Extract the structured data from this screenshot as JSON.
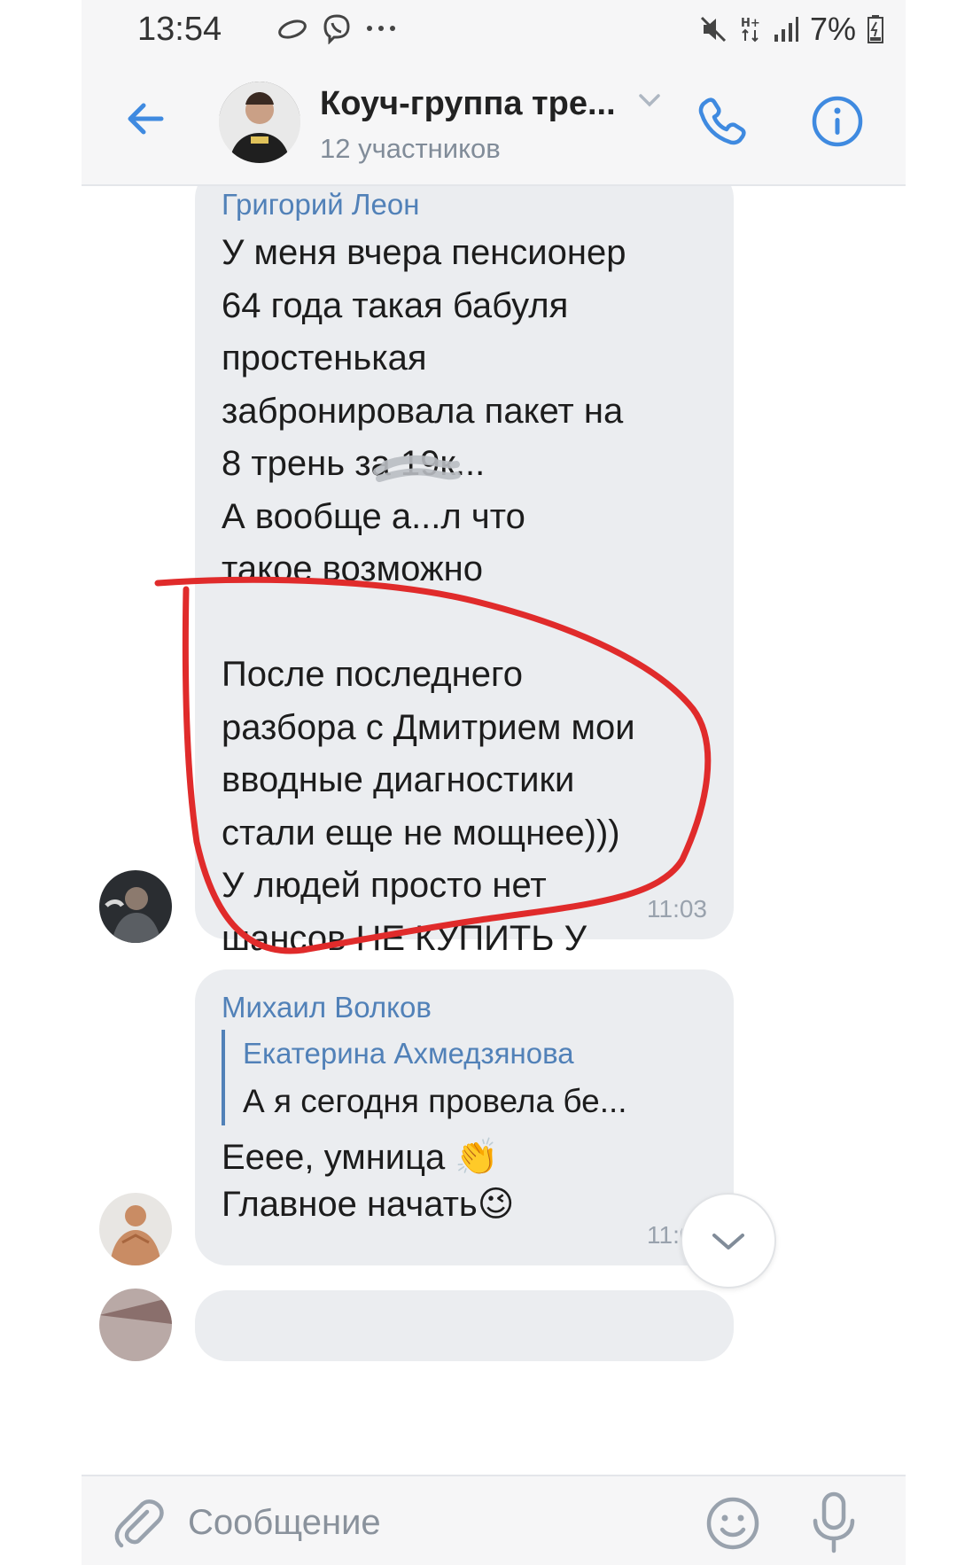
{
  "status_bar": {
    "time": "13:54",
    "battery": "7%"
  },
  "header": {
    "title": "Коуч-группа тре...",
    "subtitle": "12 участников"
  },
  "messages": [
    {
      "sender": "Григорий Леон",
      "text": "У меня вчера пенсионер\n64 года такая бабуля\nпростенькая\nзабронировала пакет на\n8 трень за 19к...\nА вообще а...л что\nтакое возможно\n\nПосле последнего\nразбора с Дмитрием мои\nвводные диагностики\nстали еще не мощнее)))\nУ людей просто нет\nшансов НЕ КУПИТЬ У\nМЕНЯ",
      "time": "11:03"
    },
    {
      "sender": "Михаил Волков",
      "reply_to_name": "Екатерина Ахмедзянова",
      "reply_to_text": "А я сегодня провела бе...",
      "text": "Еeee, умница 👏\nГлавное начать😉",
      "time": "11:04"
    }
  ],
  "composer": {
    "placeholder": "Сообщение"
  },
  "colors": {
    "accent": "#5181b8",
    "bubble": "#ebedf0",
    "annotation": "#e02b2b"
  },
  "icons": [
    "back-arrow-icon",
    "phone-icon",
    "info-icon",
    "chevron-down-icon",
    "attach-icon",
    "emoji-icon",
    "mic-icon"
  ]
}
